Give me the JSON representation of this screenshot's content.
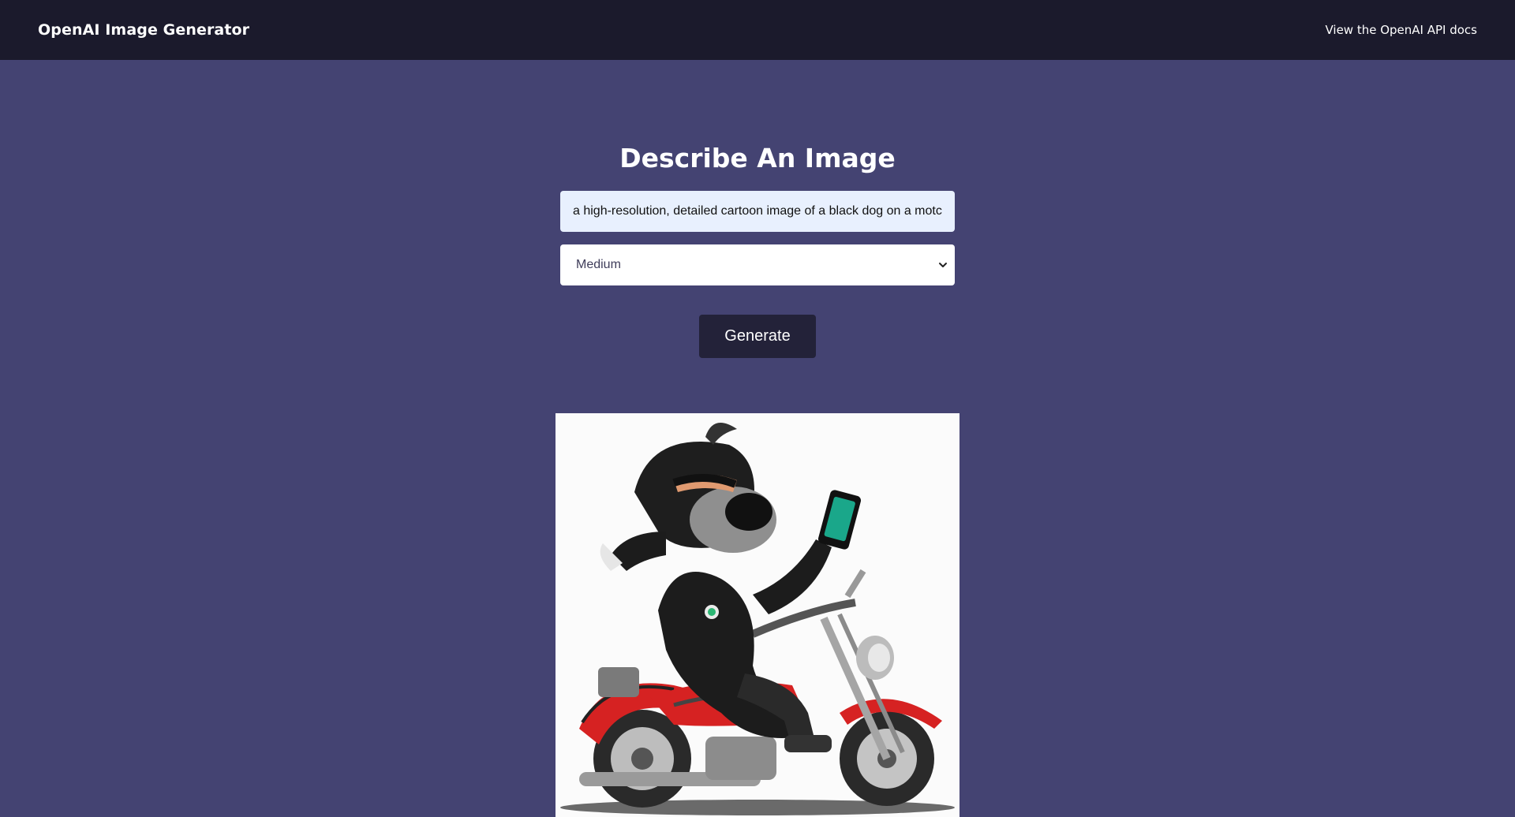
{
  "navbar": {
    "brand": "OpenAI Image Generator",
    "docs_link": "View the OpenAI API docs"
  },
  "form": {
    "heading": "Describe An Image",
    "prompt_value": "a high-resolution, detailed cartoon image of a black dog on a motc",
    "size_selected": "Medium",
    "generate_label": "Generate"
  },
  "colors": {
    "navbar_bg": "#1b1a2c",
    "page_bg": "#444372",
    "button_bg": "#232239",
    "input_bg": "#e8f0fe"
  },
  "icons": {
    "select_arrow": "chevron-down-icon"
  }
}
